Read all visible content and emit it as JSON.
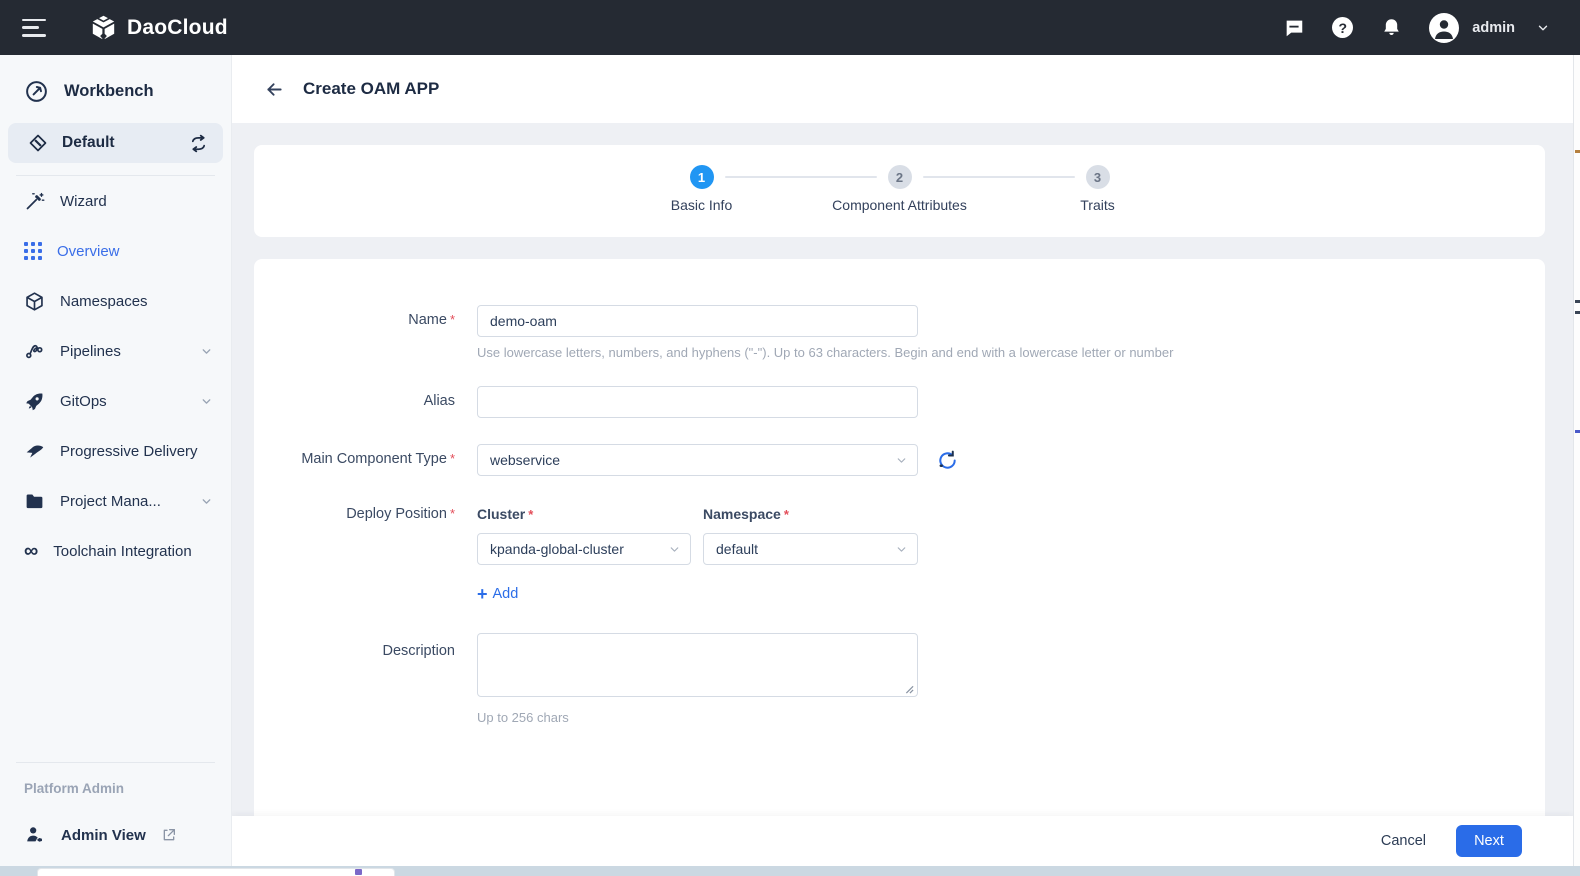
{
  "colors": {
    "topbar_bg": "#252A33",
    "accent": "#2A6CE8",
    "sidebar_active": "#3A6EE8",
    "step_active": "#2196F3",
    "required": "#E34D59",
    "page_bg": "#EEF0F4"
  },
  "icons": {
    "infinity": "∞",
    "plus": "+",
    "question_mark": "?"
  },
  "topbar": {
    "brand": "DaoCloud",
    "username": "admin"
  },
  "sidebar": {
    "section_title": "Workbench",
    "workspace_name": "Default",
    "items": [
      {
        "label": "Wizard"
      },
      {
        "label": "Overview"
      },
      {
        "label": "Namespaces"
      },
      {
        "label": "Pipelines"
      },
      {
        "label": "GitOps"
      },
      {
        "label": "Progressive Delivery"
      },
      {
        "label": "Project Mana..."
      },
      {
        "label": "Toolchain Integration"
      }
    ],
    "footer_section_title": "Platform Admin",
    "admin_view_label": "Admin View"
  },
  "page": {
    "title": "Create OAM APP"
  },
  "stepper": {
    "steps": [
      {
        "number": "1",
        "label": "Basic Info"
      },
      {
        "number": "2",
        "label": "Component Attributes"
      },
      {
        "number": "3",
        "label": "Traits"
      }
    ]
  },
  "form": {
    "required_marker": "*",
    "name": {
      "label": "Name",
      "value": "demo-oam",
      "helper": "Use lowercase letters, numbers, and hyphens (\"-\"). Up to 63 characters. Begin and end with a lowercase letter or number"
    },
    "alias": {
      "label": "Alias",
      "value": ""
    },
    "main_component_type": {
      "label": "Main Component Type",
      "value": "webservice"
    },
    "deploy_position": {
      "label": "Deploy Position",
      "cluster_label": "Cluster",
      "cluster_value": "kpanda-global-cluster",
      "namespace_label": "Namespace",
      "namespace_value": "default",
      "add_label": "Add"
    },
    "description": {
      "label": "Description",
      "value": "",
      "helper": "Up to 256 chars"
    }
  },
  "footer": {
    "cancel_label": "Cancel",
    "next_label": "Next"
  }
}
